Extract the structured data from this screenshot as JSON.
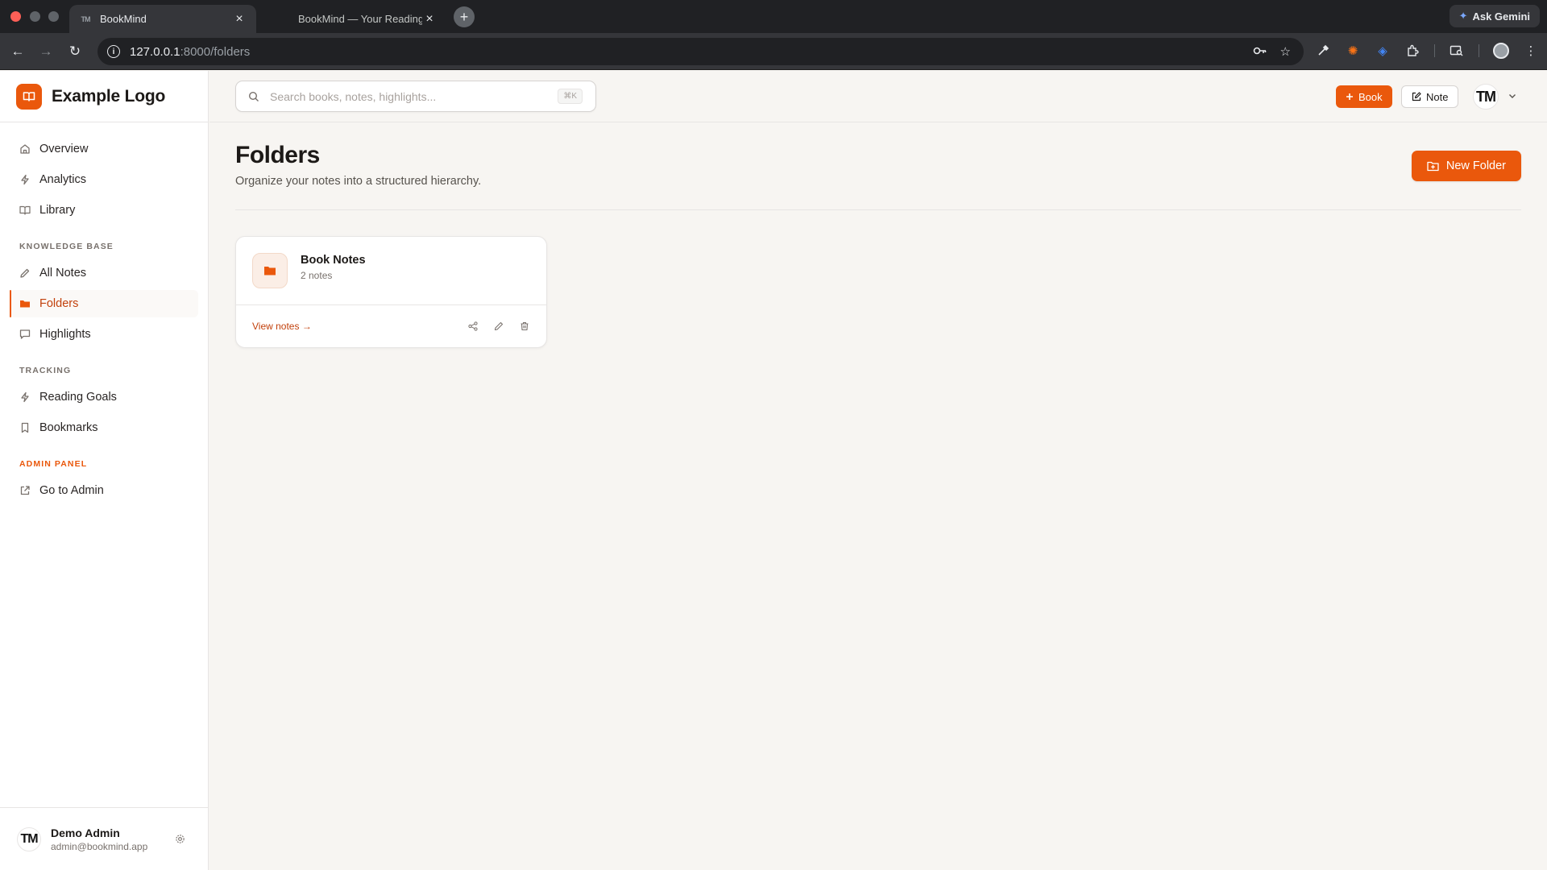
{
  "browser": {
    "tabs": [
      {
        "title": "BookMind",
        "favicon": "TM",
        "active": true
      },
      {
        "title": "BookMind — Your Reading Lif",
        "active": false
      }
    ],
    "url_host": "127.0.0.1",
    "url_path": ":8000/folders",
    "ask_gemini": "Ask Gemini"
  },
  "brand": {
    "name": "Example Logo",
    "accent": "#ea580c"
  },
  "sidebar": {
    "main_items": [
      {
        "label": "Overview",
        "icon": "home-icon"
      },
      {
        "label": "Analytics",
        "icon": "bolt-icon"
      },
      {
        "label": "Library",
        "icon": "book-open-icon"
      }
    ],
    "sections": {
      "knowledge": "KNOWLEDGE BASE",
      "tracking": "TRACKING",
      "admin": "ADMIN PANEL"
    },
    "knowledge_items": [
      {
        "label": "All Notes",
        "icon": "pencil-icon"
      },
      {
        "label": "Folders",
        "icon": "folder-icon",
        "active": true
      },
      {
        "label": "Highlights",
        "icon": "message-icon"
      }
    ],
    "tracking_items": [
      {
        "label": "Reading Goals",
        "icon": "bolt-icon"
      },
      {
        "label": "Bookmarks",
        "icon": "bookmark-icon"
      }
    ],
    "admin_items": [
      {
        "label": "Go to Admin",
        "icon": "external-link-icon"
      }
    ],
    "user": {
      "initials": "TM",
      "name": "Demo Admin",
      "email": "admin@bookmind.app"
    }
  },
  "topbar": {
    "search_placeholder": "Search books, notes, highlights...",
    "search_shortcut": "⌘K",
    "add_book": "Book",
    "add_note": "Note",
    "avatar_initials": "TM"
  },
  "page": {
    "title": "Folders",
    "subtitle": "Organize your notes into a structured hierarchy.",
    "new_folder": "New Folder"
  },
  "folders": [
    {
      "name": "Book Notes",
      "count": "2 notes",
      "view_link": "View notes →"
    }
  ]
}
